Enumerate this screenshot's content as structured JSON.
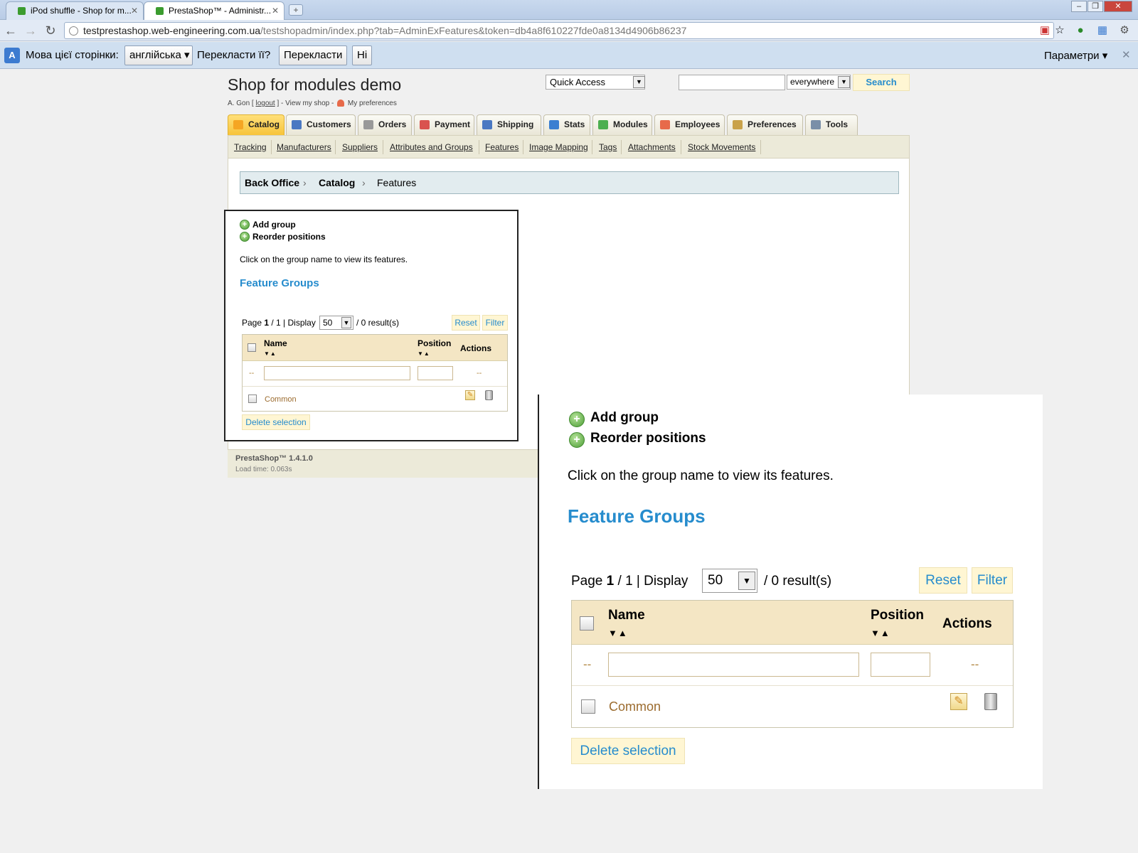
{
  "browser": {
    "tabs": [
      {
        "title": "iPod shuffle - Shop for m..."
      },
      {
        "title": "PrestaShop™ - Administr..."
      }
    ],
    "url_host": "testprestashop.web-engineering.com.ua",
    "url_path": "/testshopadmin/index.php?tab=AdminExFeatures&token=db4a8f610227fde0a8134d4906b86237",
    "translate_bar": {
      "page_lang_label": "Мова цієї сторінки:",
      "lang_value": "англійська",
      "question": "Перекласти її?",
      "translate_btn": "Перекласти",
      "no_btn": "Ні",
      "options": "Параметри"
    }
  },
  "header": {
    "shop_title": "Shop for modules demo",
    "quick_access": "Quick Access",
    "search_scope": "everywhere",
    "search_btn": "Search",
    "user": "A. Gon [",
    "logout": "logout",
    "user_mid": "] - View my shop -",
    "prefs": "My preferences"
  },
  "main_tabs": [
    {
      "label": "Catalog",
      "color": "#f5a623"
    },
    {
      "label": "Customers",
      "color": "#4a78c2"
    },
    {
      "label": "Orders",
      "color": "#999999"
    },
    {
      "label": "Payment",
      "color": "#d9534f"
    },
    {
      "label": "Shipping",
      "color": "#4a78c2"
    },
    {
      "label": "Stats",
      "color": "#3b7fd1"
    },
    {
      "label": "Modules",
      "color": "#4caf50"
    },
    {
      "label": "Employees",
      "color": "#e76a4a"
    },
    {
      "label": "Preferences",
      "color": "#c9a24a"
    },
    {
      "label": "Tools",
      "color": "#7a8fa8"
    }
  ],
  "sub_tabs": [
    "Tracking",
    "Manufacturers",
    "Suppliers",
    "Attributes and Groups",
    "Features",
    "Image Mapping",
    "Tags",
    "Attachments",
    "Stock Movements"
  ],
  "breadcrumb": [
    "Back Office",
    "Catalog",
    "Features"
  ],
  "content": {
    "add_group": "Add group",
    "reorder": "Reorder positions",
    "hint": "Click on the group name to view its features.",
    "heading": "Feature Groups",
    "page_prefix": "Page ",
    "page_cur": "1",
    "page_rest": " / 1 | Display",
    "display": "50",
    "results": "/ 0 result(s)",
    "reset": "Reset",
    "filter": "Filter",
    "col_name": "Name",
    "col_position": "Position",
    "col_actions": "Actions",
    "dash": "--",
    "row_name": "Common",
    "delete_selection": "Delete selection"
  },
  "footer": {
    "version": "PrestaShop™ 1.4.1.0",
    "load_time": "Load time: 0.063s"
  }
}
